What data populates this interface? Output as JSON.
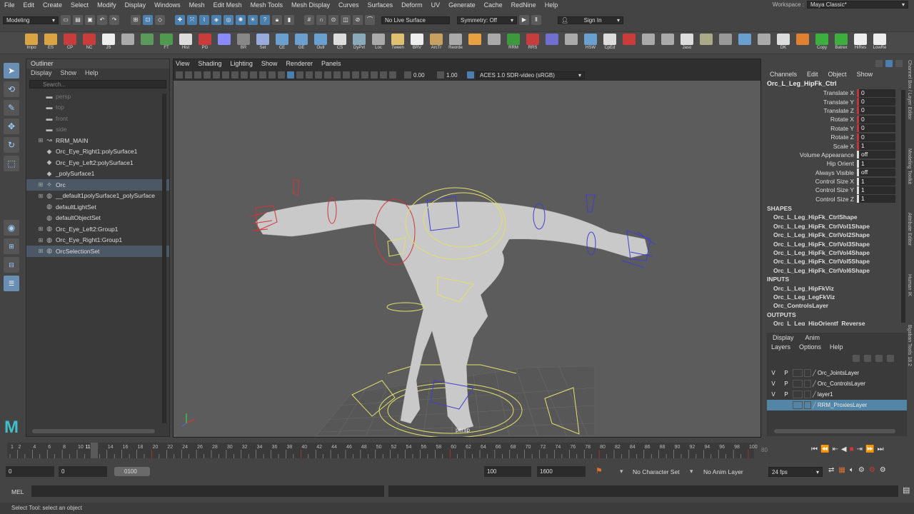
{
  "menubar": {
    "items": [
      "File",
      "Edit",
      "Create",
      "Select",
      "Modify",
      "Display",
      "Windows",
      "Mesh",
      "Edit Mesh",
      "Mesh Tools",
      "Mesh Display",
      "Curves",
      "Surfaces",
      "Deform",
      "UV",
      "Generate",
      "Cache",
      "RedNine",
      "Help"
    ],
    "workspace_label": "Workspace :",
    "workspace_value": "Maya Classic*"
  },
  "statusline": {
    "mode": "Modeling",
    "live_surface": "No Live Surface",
    "symmetry": "Symmetry: Off",
    "sign_in": "Sign In"
  },
  "shelf": {
    "items": [
      "Impo",
      "ES",
      "CP",
      "NC",
      "JS",
      "",
      "",
      "FT",
      "Hist",
      "PG",
      "",
      "BR",
      "Set",
      "CE",
      "GE",
      "Outl",
      "CS",
      "DyPvt",
      "Loc",
      "Tween",
      "BRV",
      "ArcTr",
      "Reorde",
      "",
      "",
      "RRM",
      "RRS",
      "",
      "",
      "HSW",
      "CpEd",
      "",
      "",
      "",
      "Jaso",
      "",
      "",
      "",
      "",
      "DK",
      "",
      "Copy",
      "Batrex",
      "HiRes",
      "LowRe"
    ]
  },
  "outliner": {
    "title": "Outliner",
    "menu": [
      "Display",
      "Show",
      "Help"
    ],
    "search_placeholder": "Search...",
    "rows": [
      {
        "label": "persp",
        "dim": true,
        "icon": "camera"
      },
      {
        "label": "top",
        "dim": true,
        "icon": "camera"
      },
      {
        "label": "front",
        "dim": true,
        "icon": "camera"
      },
      {
        "label": "side",
        "dim": true,
        "icon": "camera"
      },
      {
        "label": "RRM_MAIN",
        "expand": true,
        "icon": "curve"
      },
      {
        "label": "Orc_Eye_Right1:polySurface1",
        "icon": "mesh"
      },
      {
        "label": "Orc_Eye_Left2:polySurface1",
        "icon": "mesh"
      },
      {
        "label": "_polySurface1",
        "icon": "mesh"
      },
      {
        "label": "Orc",
        "expand": true,
        "icon": "joint",
        "selected": true
      },
      {
        "label": "__default1polySurface1_polySurface",
        "expand": true,
        "icon": "set"
      },
      {
        "label": "defaultLightSet",
        "icon": "set"
      },
      {
        "label": "defaultObjectSet",
        "icon": "set"
      },
      {
        "label": "Orc_Eye_Left2:Group1",
        "expand": true,
        "icon": "set"
      },
      {
        "label": "Orc_Eye_Right1:Group1",
        "expand": true,
        "icon": "set"
      },
      {
        "label": "OrcSelectionSet",
        "expand": true,
        "icon": "set",
        "selected": true
      }
    ]
  },
  "viewport": {
    "menu": [
      "View",
      "Shading",
      "Lighting",
      "Show",
      "Renderer",
      "Panels"
    ],
    "value1": "0.00",
    "value2": "1.00",
    "color_space": "ACES 1.0 SDR-video (sRGB)",
    "camera_label": "persp"
  },
  "channelbox": {
    "menu": [
      "Channels",
      "Edit",
      "Object",
      "Show"
    ],
    "object": "Orc_L_Leg_HipFk_Ctrl",
    "channels": [
      {
        "name": "Translate X",
        "value": "0",
        "accent": "red"
      },
      {
        "name": "Translate Y",
        "value": "0",
        "accent": "red"
      },
      {
        "name": "Translate Z",
        "value": "0",
        "accent": "red"
      },
      {
        "name": "Rotate X",
        "value": "0",
        "accent": "red"
      },
      {
        "name": "Rotate Y",
        "value": "0",
        "accent": "red"
      },
      {
        "name": "Rotate Z",
        "value": "0",
        "accent": "red"
      },
      {
        "name": "Scale X",
        "value": "1",
        "accent": "red"
      },
      {
        "name": "Volume Appearance",
        "value": "off",
        "accent": "white"
      },
      {
        "name": "Hip Orient",
        "value": "1",
        "accent": "white"
      },
      {
        "name": "Always Visible",
        "value": "off",
        "accent": "white"
      },
      {
        "name": "Control Size X",
        "value": "1",
        "accent": "white"
      },
      {
        "name": "Control Size Y",
        "value": "1",
        "accent": "white"
      },
      {
        "name": "Control Size Z",
        "value": "1",
        "accent": "white"
      }
    ],
    "shapes_label": "SHAPES",
    "shapes": [
      "Orc_L_Leg_HipFk_CtrlShape",
      "Orc_L_Leg_HipFk_CtrlVol1Shape",
      "Orc_L_Leg_HipFk_CtrlVol2Shape",
      "Orc_L_Leg_HipFk_CtrlVol3Shape",
      "Orc_L_Leg_HipFk_CtrlVol4Shape",
      "Orc_L_Leg_HipFk_CtrlVol5Shape",
      "Orc_L_Leg_HipFk_CtrlVol6Shape"
    ],
    "inputs_label": "INPUTS",
    "inputs": [
      "Orc_L_Leg_HipFkViz",
      "Orc_L_Leg_LegFkViz",
      "Orc_ControlsLayer"
    ],
    "outputs_label": "OUTPUTS",
    "outputs": [
      "Orc_L_Leg_HipOrientf_Reverse"
    ]
  },
  "side_tabs": [
    "Channel Box / Layer Editor",
    "Modeling Toolkit",
    "Attribute Editor",
    "Human IK",
    "Bgaban Tools 18.2"
  ],
  "layers": {
    "tabs": [
      "Display",
      "Anim"
    ],
    "menu": [
      "Layers",
      "Options",
      "Help"
    ],
    "rows": [
      {
        "v": "V",
        "p": "P",
        "name": "Orc_JointsLayer"
      },
      {
        "v": "V",
        "p": "P",
        "name": "Orc_ControlsLayer"
      },
      {
        "v": "V",
        "p": "P",
        "name": "layer1"
      },
      {
        "v": "",
        "p": "",
        "name": "RRM_ProxiesLayer",
        "selected": true
      }
    ]
  },
  "timeline": {
    "ticks": [
      "1",
      "2",
      "4",
      "6",
      "8",
      "10",
      "11",
      "12",
      "14",
      "16",
      "18",
      "20",
      "22",
      "24",
      "26",
      "28",
      "30",
      "32",
      "34",
      "36",
      "38",
      "40",
      "42",
      "44",
      "46",
      "48",
      "50",
      "52",
      "54",
      "56",
      "58",
      "60",
      "62",
      "64",
      "66",
      "68",
      "70",
      "72",
      "74",
      "76",
      "78",
      "80",
      "82",
      "84",
      "86",
      "88",
      "90",
      "92",
      "94",
      "96",
      "98",
      "100"
    ],
    "current_frame": "11",
    "end_display": "80"
  },
  "range": {
    "start": "0",
    "playback_start": "0",
    "range_label": "0100",
    "playback_end": "100",
    "end": "1600",
    "character_set": "No Character Set",
    "anim_layer": "No Anim Layer",
    "fps": "24 fps"
  },
  "cmdline": {
    "label": "MEL"
  },
  "helpline": {
    "text": "Select Tool: select an object"
  }
}
